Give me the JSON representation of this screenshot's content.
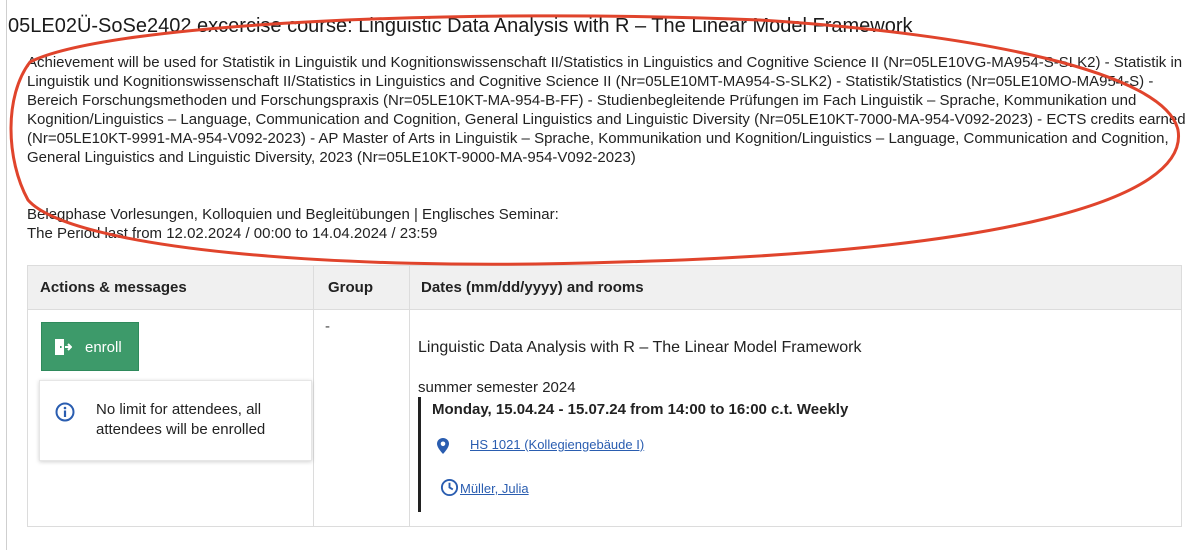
{
  "course": {
    "title": "05LE02Ü-SoSe2402 excercise course: Linguistic Data Analysis with R – The Linear Model Framework"
  },
  "achievement": {
    "text": "Achievement will be used for Statistik in Linguistik und Kognitionswissenschaft II/Statistics in Linguistics and Cognitive Science II (Nr=05LE10VG-MA954-S-SLK2) - Statistik in Linguistik und Kognitionswissenschaft II/Statistics in Linguistics and Cognitive Science II (Nr=05LE10MT-MA954-S-SLK2) - Statistik/Statistics (Nr=05LE10MO-MA954-S) - Bereich Forschungsmethoden und Forschungspraxis (Nr=05LE10KT-MA-954-B-FF) - Studienbegleitende Prüfungen im Fach Linguistik – Sprache, Kommunikation und Kognition/Linguistics – Language, Communication and Cognition, General Linguistics and Linguistic Diversity (Nr=05LE10KT-7000-MA-954-V092-2023) - ECTS credits earned (Nr=05LE10KT-9991-MA-954-V092-2023) - AP Master of Arts in Linguistik – Sprache, Kommunikation und Kognition/Linguistics – Language, Communication and Cognition, General Linguistics and Linguistic Diversity, 2023 (Nr=05LE10KT-9000-MA-954-V092-2023)"
  },
  "period": {
    "phase": "Belegphase Vorlesungen, Kolloquien und Begleitübungen | Englisches Seminar:",
    "range": "The Period last from 12.02.2024 / 00:00 to 14.04.2024 / 23:59"
  },
  "table": {
    "headers": {
      "actions": "Actions & messages",
      "group": "Group",
      "dates": "Dates (mm/dd/yyyy) and rooms"
    },
    "row": {
      "enroll_label": "enroll",
      "info_text": "No limit for attendees, all attendees will be enrolled",
      "group": "-",
      "appointment_title": "Linguistic Data Analysis with R – The Linear Model Framework",
      "semester": "summer semester 2024",
      "schedule": "Monday, 15.04.24 - 15.07.24 from 14:00 to 16:00 c.t. Weekly",
      "room": "HS 1021 (Kollegiengebäude I)",
      "lecturer": "Müller, Julia"
    }
  },
  "colors": {
    "enroll_button": "#3d9a6a",
    "link": "#2a5db0",
    "info_icon": "#2a5db0",
    "annotation_oval": "#e0442c",
    "header_bg": "#f0f0f0"
  },
  "icons": {
    "enroll": "enroll-door-icon",
    "info": "info-circle-icon",
    "room": "map-pin-icon",
    "lecturer": "clock-icon"
  }
}
